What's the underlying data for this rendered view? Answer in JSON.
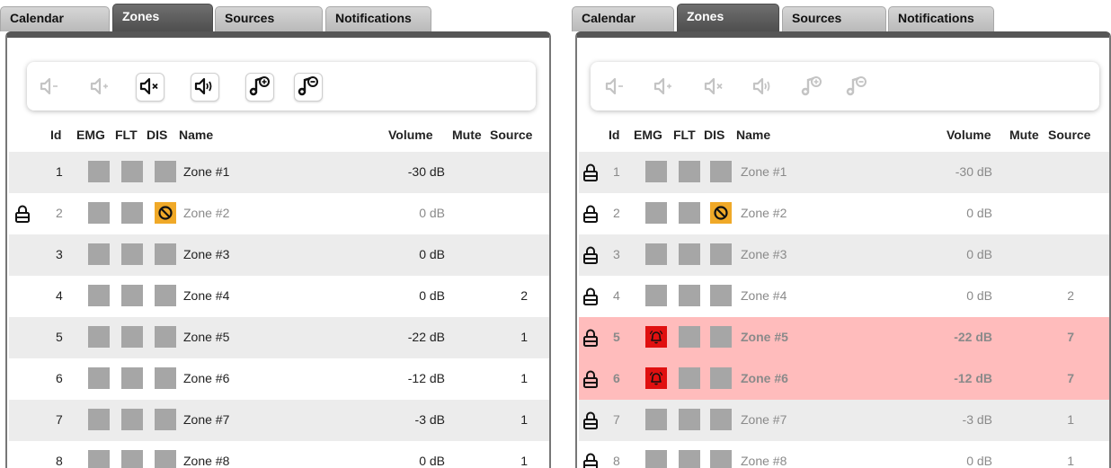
{
  "tabs": [
    "Calendar",
    "Zones",
    "Sources",
    "Notifications"
  ],
  "columns": {
    "id": "Id",
    "emg": "EMG",
    "flt": "FLT",
    "dis": "DIS",
    "name": "Name",
    "volume": "Volume",
    "mute": "Mute",
    "source": "Source"
  },
  "toolbar_icons": [
    "volume-down-icon",
    "volume-up-icon",
    "mute-icon",
    "unmute-icon",
    "add-source-icon",
    "remove-source-icon"
  ],
  "colors": {
    "active_tab": "#565656",
    "dis_badge": "#f0a928",
    "emg_badge": "#e01010",
    "alarm_row": "#ffbcbc",
    "shaded_row": "#ececec",
    "indicator": "#a6a6a6"
  },
  "left_panel": {
    "toolbar_enabled": [
      false,
      false,
      true,
      true,
      true,
      true
    ],
    "rows": [
      {
        "id": "1",
        "name": "Zone #1",
        "volume": "-30 dB",
        "source": "",
        "locked": false,
        "dis": false,
        "emg": false,
        "dim": false,
        "alarm": false
      },
      {
        "id": "2",
        "name": "Zone #2",
        "volume": "0 dB",
        "source": "",
        "locked": true,
        "dis": true,
        "emg": false,
        "dim": true,
        "alarm": false
      },
      {
        "id": "3",
        "name": "Zone #3",
        "volume": "0 dB",
        "source": "",
        "locked": false,
        "dis": false,
        "emg": false,
        "dim": false,
        "alarm": false
      },
      {
        "id": "4",
        "name": "Zone #4",
        "volume": "0 dB",
        "source": "2",
        "locked": false,
        "dis": false,
        "emg": false,
        "dim": false,
        "alarm": false
      },
      {
        "id": "5",
        "name": "Zone #5",
        "volume": "-22 dB",
        "source": "1",
        "locked": false,
        "dis": false,
        "emg": false,
        "dim": false,
        "alarm": false
      },
      {
        "id": "6",
        "name": "Zone #6",
        "volume": "-12 dB",
        "source": "1",
        "locked": false,
        "dis": false,
        "emg": false,
        "dim": false,
        "alarm": false
      },
      {
        "id": "7",
        "name": "Zone #7",
        "volume": "-3 dB",
        "source": "1",
        "locked": false,
        "dis": false,
        "emg": false,
        "dim": false,
        "alarm": false
      },
      {
        "id": "8",
        "name": "Zone #8",
        "volume": "0 dB",
        "source": "1",
        "locked": false,
        "dis": false,
        "emg": false,
        "dim": false,
        "alarm": false
      }
    ]
  },
  "right_panel": {
    "toolbar_enabled": [
      false,
      false,
      false,
      false,
      false,
      false
    ],
    "rows": [
      {
        "id": "1",
        "name": "Zone #1",
        "volume": "-30 dB",
        "source": "",
        "locked": true,
        "dis": false,
        "emg": false,
        "dim": true,
        "alarm": false
      },
      {
        "id": "2",
        "name": "Zone #2",
        "volume": "0 dB",
        "source": "",
        "locked": true,
        "dis": true,
        "emg": false,
        "dim": true,
        "alarm": false
      },
      {
        "id": "3",
        "name": "Zone #3",
        "volume": "0 dB",
        "source": "",
        "locked": true,
        "dis": false,
        "emg": false,
        "dim": true,
        "alarm": false
      },
      {
        "id": "4",
        "name": "Zone #4",
        "volume": "0 dB",
        "source": "2",
        "locked": true,
        "dis": false,
        "emg": false,
        "dim": true,
        "alarm": false
      },
      {
        "id": "5",
        "name": "Zone #5",
        "volume": "-22 dB",
        "source": "7",
        "locked": true,
        "dis": false,
        "emg": true,
        "dim": true,
        "alarm": true
      },
      {
        "id": "6",
        "name": "Zone #6",
        "volume": "-12 dB",
        "source": "7",
        "locked": true,
        "dis": false,
        "emg": true,
        "dim": true,
        "alarm": true
      },
      {
        "id": "7",
        "name": "Zone #7",
        "volume": "-3 dB",
        "source": "1",
        "locked": true,
        "dis": false,
        "emg": false,
        "dim": true,
        "alarm": false
      },
      {
        "id": "8",
        "name": "Zone #8",
        "volume": "0 dB",
        "source": "1",
        "locked": true,
        "dis": false,
        "emg": false,
        "dim": true,
        "alarm": false
      }
    ]
  }
}
